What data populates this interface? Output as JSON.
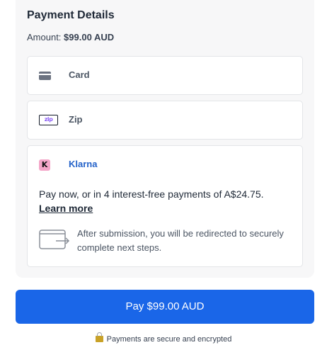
{
  "payment": {
    "title": "Payment Details",
    "amount_label": "Amount:",
    "amount_value": "$99.00 AUD"
  },
  "options": {
    "card": {
      "label": "Card",
      "icon": "credit-card-icon"
    },
    "zip": {
      "label": "Zip",
      "icon": "zip-logo-icon",
      "icon_text": "zip"
    },
    "klarna": {
      "label": "Klarna",
      "icon": "klarna-logo-icon",
      "icon_text": "K",
      "description": "Pay now, or in 4 interest-free payments of A$24.75.",
      "learn_more": "Learn more",
      "redirect_note": "After submission, you will be redirected to securely complete next steps."
    }
  },
  "pay_button": {
    "label": "Pay $99.00 AUD"
  },
  "security_note": {
    "text": "Payments are secure and encrypted",
    "icon": "lock-icon"
  },
  "colors": {
    "primary": "#1a66e8",
    "klarna_pink": "#f4a6c8",
    "klarna_link": "#2563c9",
    "panel_bg": "#f7f7f8"
  }
}
